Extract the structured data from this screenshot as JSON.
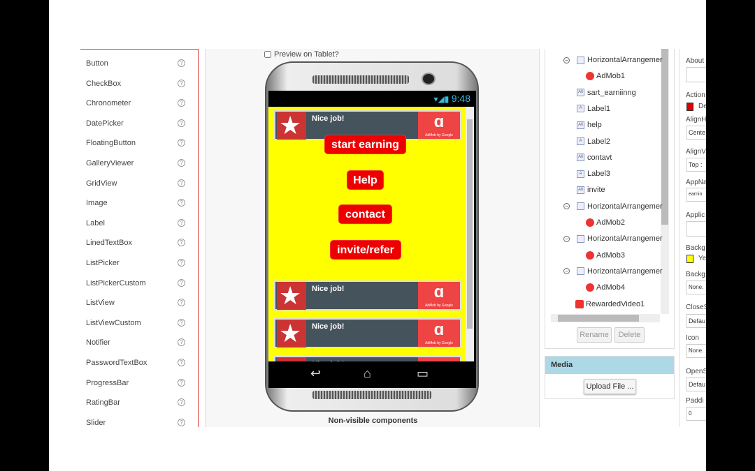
{
  "palette": {
    "items": [
      "Button",
      "CheckBox",
      "Chronometer",
      "DatePicker",
      "FloatingButton",
      "GalleryViewer",
      "GridView",
      "Image",
      "Label",
      "LinedTextBox",
      "ListPicker",
      "ListPickerCustom",
      "ListView",
      "ListViewCustom",
      "Notifier",
      "PasswordTextBox",
      "ProgressBar",
      "RatingBar",
      "Slider"
    ],
    "help_icon": "?"
  },
  "viewer": {
    "preview_label": "Preview on Tablet?",
    "preview_checked": false,
    "status_time": "9:48",
    "ad_text": "Nice job!",
    "ad_star_text": "Nice job",
    "ad_logo_text": "AdMob by Google",
    "buttons": [
      "start earning",
      "Help",
      "contact",
      "invite/refer"
    ],
    "non_visible": "Non-visible components",
    "content_bg": "#ffff00",
    "button_color": "#ee0000"
  },
  "tree": {
    "nodes": [
      {
        "label": "HorizontalArrangemer",
        "type": "arrangement"
      },
      {
        "label": "AdMob1",
        "type": "admob"
      },
      {
        "label": "sart_earniinng",
        "type": "button"
      },
      {
        "label": "Label1",
        "type": "label"
      },
      {
        "label": "help",
        "type": "button"
      },
      {
        "label": "Label2",
        "type": "label"
      },
      {
        "label": "contavt",
        "type": "button"
      },
      {
        "label": "Label3",
        "type": "label"
      },
      {
        "label": "invite",
        "type": "button"
      },
      {
        "label": "HorizontalArrangemer",
        "type": "arrangement"
      },
      {
        "label": "AdMob2",
        "type": "admob"
      },
      {
        "label": "HorizontalArrangemer",
        "type": "arrangement"
      },
      {
        "label": "AdMob3",
        "type": "admob"
      },
      {
        "label": "HorizontalArrangemer",
        "type": "arrangement"
      },
      {
        "label": "AdMob4",
        "type": "admob"
      },
      {
        "label": "RewardedVideo1",
        "type": "video"
      }
    ],
    "rename": "Rename",
    "delete": "Delete"
  },
  "media": {
    "title": "Media",
    "upload": "Upload File ..."
  },
  "properties": {
    "about": "About",
    "action": "Action",
    "action_val": "De",
    "align_h": "AlignH",
    "align_h_val": "Cente",
    "align_v": "AlignV",
    "align_v_val": "Top :",
    "appname": "AppNa",
    "appname_val": "earnin",
    "applic": "Applic",
    "backg": "Backg",
    "backg_val": "Ye",
    "backg2": "Backg",
    "backg2_val": "None.",
    "close": "CloseS",
    "close_val": "Defau",
    "icon": "Icon",
    "icon_val": "None.",
    "open": "OpenS",
    "open_val": "Defau",
    "padding": "Paddi",
    "padding_val": "0",
    "action_color": "#dd0000",
    "bg_color": "#ffff00"
  }
}
